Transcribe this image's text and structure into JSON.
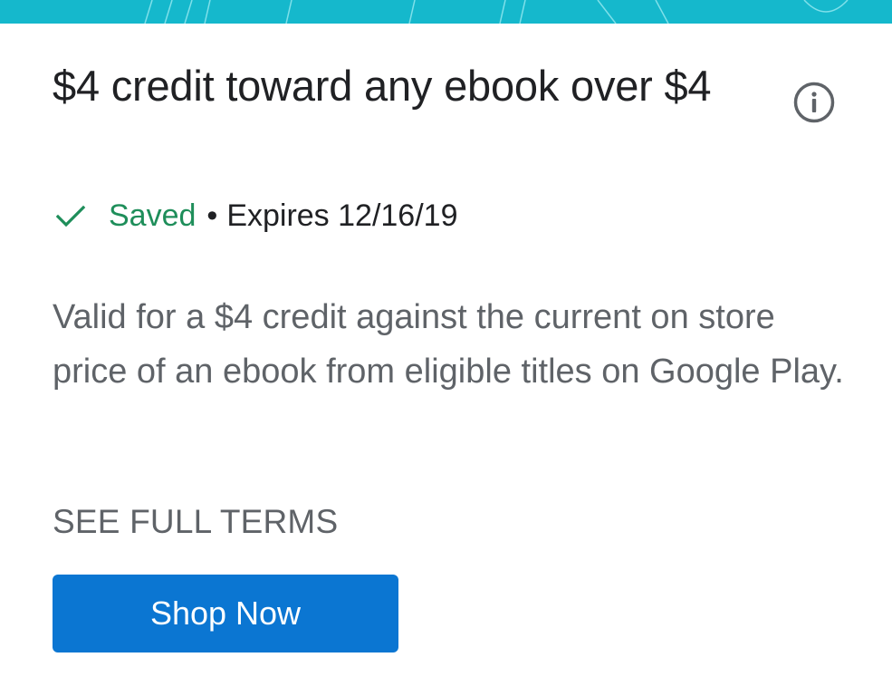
{
  "offer": {
    "title": "$4 credit toward any ebook over $4",
    "status": {
      "saved_label": "Saved",
      "separator": "•",
      "expires": "Expires 12/16/19"
    },
    "description": "Valid for a $4 credit against the current on store price of an ebook from eligible titles on Google Play.",
    "terms_link": "SEE FULL TERMS",
    "cta_label": "Shop Now"
  },
  "icons": {
    "info": "info-icon",
    "check": "check-icon"
  },
  "colors": {
    "banner": "#15b8cc",
    "saved_green": "#1e8e5a",
    "button_blue": "#0b76d2",
    "title_text": "#202124",
    "body_text": "#5f6368"
  }
}
